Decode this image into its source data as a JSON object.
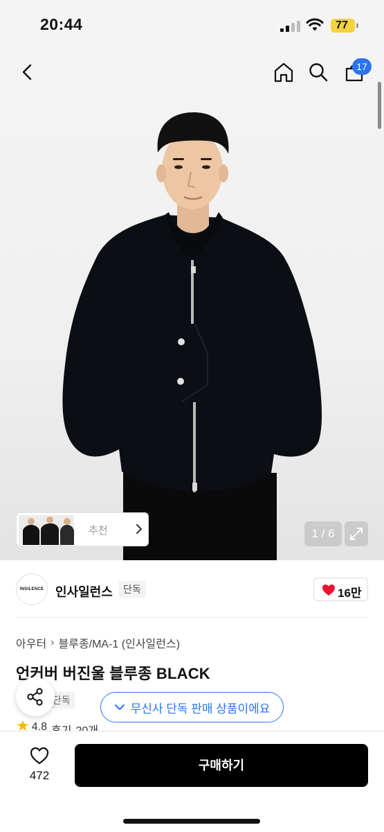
{
  "status_bar": {
    "time": "20:44",
    "battery": "77",
    "colors": {
      "battery_fill": "#f5d33f"
    }
  },
  "header": {
    "icons": [
      "back-icon",
      "home-icon",
      "search-icon",
      "cart-icon"
    ],
    "cart_badge": "17",
    "colors": {
      "badge": "#2a74f0"
    }
  },
  "gallery": {
    "recommend_label": "추천",
    "page_counter": "1 / 6"
  },
  "brand": {
    "logo_text": "INSILENCE",
    "name": "인사일런스",
    "exclusive_tag": "단독",
    "likes": "16만",
    "colors": {
      "heart": "#e8132f"
    }
  },
  "product": {
    "breadcrumb": [
      "아우터",
      "블루종/MA-1 (인사일런스)"
    ],
    "title": "언커버 버진울 블루종 BLACK",
    "exclusive_tag": "단독",
    "exclusive_banner": "무신사 단독 판매 상품이에요",
    "rating": "4.8",
    "review_label": "후기",
    "review_count": "20개",
    "colors": {
      "accent": "#2a74f0",
      "star": "#f5b800"
    }
  },
  "bottom_bar": {
    "wish_count": "472",
    "buy_label": "구매하기"
  }
}
